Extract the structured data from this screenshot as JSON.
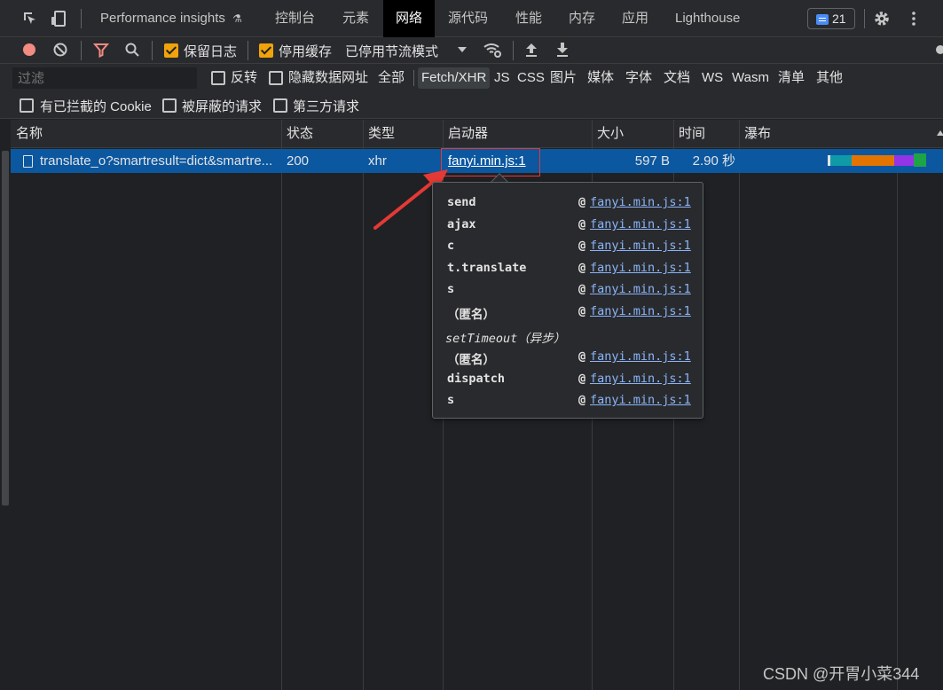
{
  "tabs": {
    "perf_insights": "Performance insights",
    "console": "控制台",
    "elements": "元素",
    "network": "网络",
    "sources": "源代码",
    "performance": "性能",
    "memory": "内存",
    "application": "应用",
    "lighthouse": "Lighthouse",
    "issues_count": "21"
  },
  "toolbar": {
    "preserve_log": "保留日志",
    "disable_cache": "停用缓存",
    "throttle": "已停用节流模式"
  },
  "filter": {
    "placeholder": "过滤",
    "invert": "反转",
    "hide_data_urls": "隐藏数据网址",
    "types": [
      "全部",
      "Fetch/XHR",
      "JS",
      "CSS",
      "图片",
      "媒体",
      "字体",
      "文档",
      "WS",
      "Wasm",
      "清单",
      "其他"
    ],
    "blocked_cookies": "有已拦截的 Cookie",
    "blocked_requests": "被屏蔽的请求",
    "third_party": "第三方请求"
  },
  "table": {
    "headers": {
      "name": "名称",
      "status": "状态",
      "type": "类型",
      "initiator": "启动器",
      "size": "大小",
      "time": "时间",
      "waterfall": "瀑布"
    },
    "row": {
      "name": "translate_o?smartresult=dict&smartre...",
      "status": "200",
      "type": "xhr",
      "initiator": "fanyi.min.js:1",
      "size": "597 B",
      "time": "2.90 秒"
    }
  },
  "popup": {
    "frames": [
      {
        "fn": "send",
        "at": "@",
        "loc": "fanyi.min.js:1"
      },
      {
        "fn": "ajax",
        "at": "@",
        "loc": "fanyi.min.js:1"
      },
      {
        "fn": "c",
        "at": "@",
        "loc": "fanyi.min.js:1"
      },
      {
        "fn": "t.translate",
        "at": "@",
        "loc": "fanyi.min.js:1"
      },
      {
        "fn": "s",
        "at": "@",
        "loc": "fanyi.min.js:1"
      },
      {
        "fn": "（匿名）",
        "at": "@",
        "loc": "fanyi.min.js:1"
      }
    ],
    "async_label": "setTimeout（异步）",
    "frames2": [
      {
        "fn": "（匿名）",
        "at": "@",
        "loc": "fanyi.min.js:1"
      },
      {
        "fn": "dispatch",
        "at": "@",
        "loc": "fanyi.min.js:1"
      },
      {
        "fn": "s",
        "at": "@",
        "loc": "fanyi.min.js:1"
      }
    ]
  },
  "watermark": "CSDN @开胃小菜344",
  "colors": {
    "selected_row": "#0b57a0",
    "annotation_red": "#e53935",
    "checkbox_on": "#f0a30a",
    "link": "#8ab4f8"
  }
}
